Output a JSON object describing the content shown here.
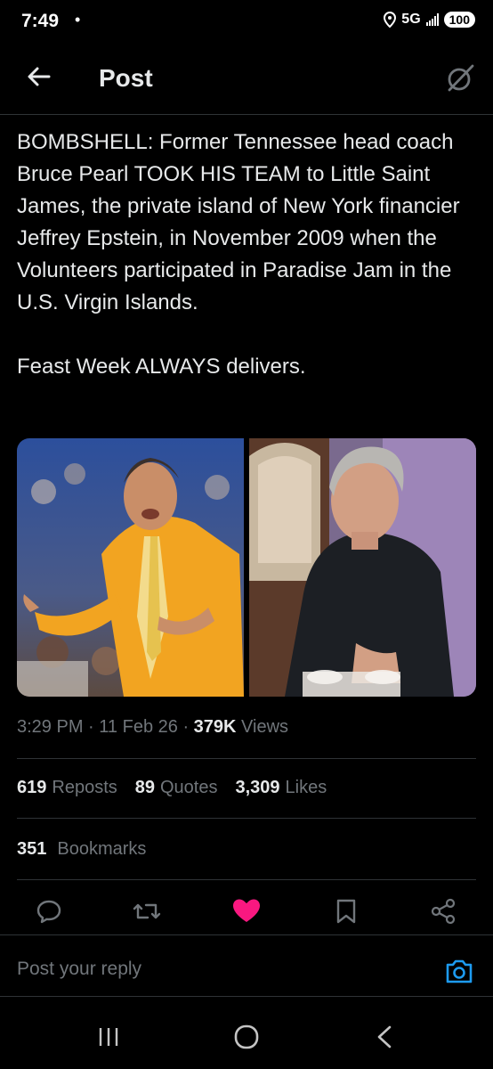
{
  "status_bar": {
    "time": "7:49",
    "dot": "•",
    "network": "5G",
    "battery": "100",
    "icons": [
      "location-icon",
      "signal-icon",
      "battery-icon"
    ]
  },
  "header": {
    "title": "Post",
    "icons": [
      "back-arrow-icon",
      "grok-icon"
    ]
  },
  "post": {
    "text": "BOMBSHELL: Former Tennessee head coach Bruce Pearl TOOK HIS TEAM to Little Saint James, the private island of New York financier Jeffrey Epstein, in November 2009 when the Volunteers participated in Paradise Jam in the U.S. Virgin Islands.\n\nFeast Week ALWAYS delivers.",
    "time": "3:29 PM",
    "date": "11 Feb 26",
    "views_count": "379K",
    "views_label": "Views",
    "separator": "·"
  },
  "stats": {
    "reposts_count": "619",
    "reposts_label": "Reposts",
    "quotes_count": "89",
    "quotes_label": "Quotes",
    "likes_count": "3,309",
    "likes_label": "Likes",
    "bookmarks_count": "351",
    "bookmarks_label": "Bookmarks"
  },
  "actions": {
    "icons": [
      "reply-icon",
      "repost-icon",
      "like-icon",
      "bookmark-icon",
      "share-icon"
    ],
    "like_color": "#f91880"
  },
  "reply": {
    "placeholder": "Post your reply",
    "camera_color": "#1d9bf0"
  },
  "nav": {
    "icons": [
      "recents-icon",
      "home-icon",
      "back-icon"
    ]
  }
}
